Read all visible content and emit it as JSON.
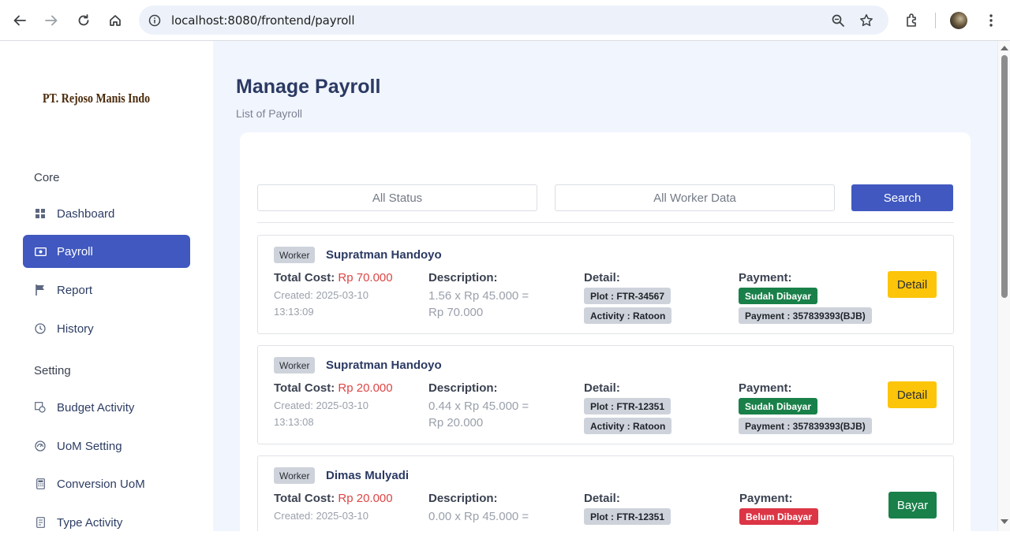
{
  "browser": {
    "url": "localhost:8080/frontend/payroll"
  },
  "sidebar": {
    "logo_text": "PT. Rejoso Manis Indo",
    "sections": [
      {
        "label": "Core"
      },
      {
        "label": "Setting"
      }
    ],
    "items": [
      {
        "label": "Dashboard",
        "icon": "grid-icon"
      },
      {
        "label": "Payroll",
        "icon": "money-icon",
        "active": true
      },
      {
        "label": "Report",
        "icon": "flag-icon"
      },
      {
        "label": "History",
        "icon": "clock-icon"
      },
      {
        "label": "Budget Activity",
        "icon": "budget-icon"
      },
      {
        "label": "UoM Setting",
        "icon": "gauge-icon"
      },
      {
        "label": "Conversion UoM",
        "icon": "calculator-icon"
      },
      {
        "label": "Type Activity",
        "icon": "document-icon"
      }
    ]
  },
  "header": {
    "title": "Manage Payroll",
    "subtitle": "List of Payroll"
  },
  "filters": {
    "status_placeholder": "All Status",
    "worker_placeholder": "All Worker Data",
    "search_label": "Search"
  },
  "payrolls": [
    {
      "worker_tag": "Worker",
      "worker_name": "Supratman Handoyo",
      "total_cost_label": "Total Cost:",
      "total_cost": "Rp 70.000",
      "created_line1": "Created: 2025-03-10",
      "created_line2": "13:13:09",
      "description_label": "Description:",
      "description_line1": "1.56 x Rp 45.000 =",
      "description_line2": "Rp 70.000",
      "detail_label": "Detail:",
      "plot": "Plot : FTR-34567",
      "activity": "Activity : Ratoon",
      "payment_label": "Payment:",
      "payment_status": "Sudah Dibayar",
      "payment_ref": "Payment : 357839393(BJB)",
      "action": "Detail"
    },
    {
      "worker_tag": "Worker",
      "worker_name": "Supratman Handoyo",
      "total_cost_label": "Total Cost:",
      "total_cost": "Rp 20.000",
      "created_line1": "Created: 2025-03-10",
      "created_line2": "13:13:08",
      "description_label": "Description:",
      "description_line1": "0.44 x Rp 45.000 =",
      "description_line2": "Rp 20.000",
      "detail_label": "Detail:",
      "plot": "Plot : FTR-12351",
      "activity": "Activity : Ratoon",
      "payment_label": "Payment:",
      "payment_status": "Sudah Dibayar",
      "payment_ref": "Payment : 357839393(BJB)",
      "action": "Detail"
    },
    {
      "worker_tag": "Worker",
      "worker_name": "Dimas Mulyadi",
      "total_cost_label": "Total Cost:",
      "total_cost": "Rp 20.000",
      "created_line1": "Created: 2025-03-10",
      "created_line2": "",
      "description_label": "Description:",
      "description_line1": "0.00 x Rp 45.000 =",
      "description_line2": "",
      "detail_label": "Detail:",
      "plot": "Plot : FTR-12351",
      "activity": "",
      "payment_label": "Payment:",
      "payment_status": "Belum Dibayar",
      "payment_ref": "",
      "action": "Bayar"
    }
  ],
  "colors": {
    "primary": "#4058bf",
    "success": "#198049",
    "danger": "#dc3545",
    "warning": "#fcc50a",
    "cost": "#dd4545"
  }
}
